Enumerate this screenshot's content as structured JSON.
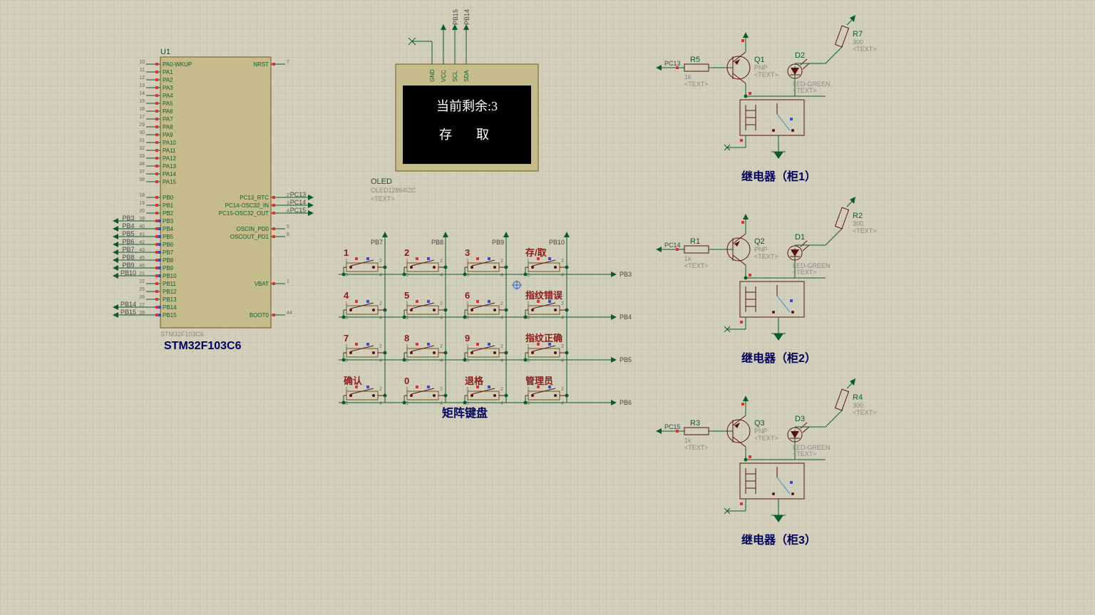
{
  "mcu": {
    "ref": "U1",
    "part": "STM32F103C6",
    "title": "STM32F103C6",
    "left_pins": [
      {
        "num": "10",
        "name": "PA0-WKUP"
      },
      {
        "num": "11",
        "name": "PA1"
      },
      {
        "num": "12",
        "name": "PA2"
      },
      {
        "num": "13",
        "name": "PA3"
      },
      {
        "num": "14",
        "name": "PA4"
      },
      {
        "num": "15",
        "name": "PA5"
      },
      {
        "num": "16",
        "name": "PA6"
      },
      {
        "num": "17",
        "name": "PA7"
      },
      {
        "num": "29",
        "name": "PA8"
      },
      {
        "num": "30",
        "name": "PA9"
      },
      {
        "num": "31",
        "name": "PA10"
      },
      {
        "num": "32",
        "name": "PA11"
      },
      {
        "num": "33",
        "name": "PA12"
      },
      {
        "num": "34",
        "name": "PA13"
      },
      {
        "num": "37",
        "name": "PA14"
      },
      {
        "num": "38",
        "name": "PA15"
      },
      {
        "num": "",
        "name": ""
      },
      {
        "num": "18",
        "name": "PB0"
      },
      {
        "num": "19",
        "name": "PB1"
      },
      {
        "num": "20",
        "name": "PB2"
      },
      {
        "num": "39",
        "name": "PB3",
        "net": "PB3"
      },
      {
        "num": "40",
        "name": "PB4",
        "net": "PB4"
      },
      {
        "num": "41",
        "name": "PB5",
        "net": "PB5"
      },
      {
        "num": "42",
        "name": "PB6",
        "net": "PB6"
      },
      {
        "num": "43",
        "name": "PB7",
        "net": "PB7"
      },
      {
        "num": "45",
        "name": "PB8",
        "net": "PB8"
      },
      {
        "num": "46",
        "name": "PB9",
        "net": "PB9"
      },
      {
        "num": "21",
        "name": "PB10",
        "net": "PB10"
      },
      {
        "num": "22",
        "name": "PB11"
      },
      {
        "num": "25",
        "name": "PB12"
      },
      {
        "num": "26",
        "name": "PB13"
      },
      {
        "num": "27",
        "name": "PB14",
        "net": "PB14"
      },
      {
        "num": "28",
        "name": "PB15",
        "net": "PB15"
      }
    ],
    "right_pins": [
      {
        "num": "7",
        "name": "NRST"
      },
      {
        "num": "",
        "name": ""
      },
      {
        "num": "",
        "name": ""
      },
      {
        "num": "",
        "name": ""
      },
      {
        "num": "",
        "name": ""
      },
      {
        "num": "",
        "name": ""
      },
      {
        "num": "",
        "name": ""
      },
      {
        "num": "",
        "name": ""
      },
      {
        "num": "",
        "name": ""
      },
      {
        "num": "",
        "name": ""
      },
      {
        "num": "",
        "name": ""
      },
      {
        "num": "",
        "name": ""
      },
      {
        "num": "",
        "name": ""
      },
      {
        "num": "",
        "name": ""
      },
      {
        "num": "",
        "name": ""
      },
      {
        "num": "",
        "name": ""
      },
      {
        "num": "",
        "name": ""
      },
      {
        "num": "2",
        "name": "PC13_RTC",
        "net": "PC13"
      },
      {
        "num": "3",
        "name": "PC14-OSC32_IN",
        "net": "PC14"
      },
      {
        "num": "4",
        "name": "PC15-OSC32_OUT",
        "net": "PC15"
      },
      {
        "num": "",
        "name": ""
      },
      {
        "num": "5",
        "name": "OSCIN_PD0"
      },
      {
        "num": "6",
        "name": "OSCOUT_PD1"
      },
      {
        "num": "",
        "name": ""
      },
      {
        "num": "",
        "name": ""
      },
      {
        "num": "",
        "name": ""
      },
      {
        "num": "",
        "name": ""
      },
      {
        "num": "",
        "name": ""
      },
      {
        "num": "1",
        "name": "VBAT"
      },
      {
        "num": "",
        "name": ""
      },
      {
        "num": "",
        "name": ""
      },
      {
        "num": "",
        "name": ""
      },
      {
        "num": "44",
        "name": "BOOT0"
      }
    ]
  },
  "oled": {
    "ref": "OLED",
    "part": "OLED12864I2C",
    "text_placeholder": "<TEXT>",
    "pins": [
      "GND",
      "VCC",
      "SCL",
      "SDA"
    ],
    "pin_nets": [
      "",
      "",
      "PB15",
      "PB14"
    ],
    "line1": "当前剩余:3",
    "line2": "存　取"
  },
  "keypad": {
    "title": "矩阵键盘",
    "cols": [
      "PB7",
      "PB8",
      "PB9",
      "PB10"
    ],
    "rows": [
      "PB3",
      "PB4",
      "PB5",
      "PB6"
    ],
    "keys": [
      [
        "1",
        "2",
        "3",
        "存/取"
      ],
      [
        "4",
        "5",
        "6",
        "指纹错误"
      ],
      [
        "7",
        "8",
        "9",
        "指纹正确"
      ],
      [
        "确认",
        "0",
        "退格",
        "管理员"
      ]
    ]
  },
  "relays": [
    {
      "title": "继电器（柜1）",
      "pc": "PC13",
      "r_in": {
        "ref": "R5",
        "val": "1k",
        "text": "<TEXT>"
      },
      "q": {
        "ref": "Q1",
        "val": "PNP",
        "text": "<TEXT>"
      },
      "d": {
        "ref": "D2",
        "val": "LED-GREEN",
        "text": "<TEXT>"
      },
      "r_led": {
        "ref": "R7",
        "val": "300",
        "text": "<TEXT>"
      }
    },
    {
      "title": "继电器（柜2）",
      "pc": "PC14",
      "r_in": {
        "ref": "R1",
        "val": "1k",
        "text": "<TEXT>"
      },
      "q": {
        "ref": "Q2",
        "val": "PNP",
        "text": "<TEXT>"
      },
      "d": {
        "ref": "D1",
        "val": "LED-GREEN",
        "text": "<TEXT>"
      },
      "r_led": {
        "ref": "R2",
        "val": "300",
        "text": "<TEXT>"
      }
    },
    {
      "title": "继电器（柜3）",
      "pc": "PC15",
      "r_in": {
        "ref": "R3",
        "val": "1k",
        "text": "<TEXT>"
      },
      "q": {
        "ref": "Q3",
        "val": "PNP",
        "text": "<TEXT>"
      },
      "d": {
        "ref": "D3",
        "val": "LED-GREEN",
        "text": "<TEXT>"
      },
      "r_led": {
        "ref": "R4",
        "val": "300",
        "text": "<TEXT>"
      }
    }
  ]
}
